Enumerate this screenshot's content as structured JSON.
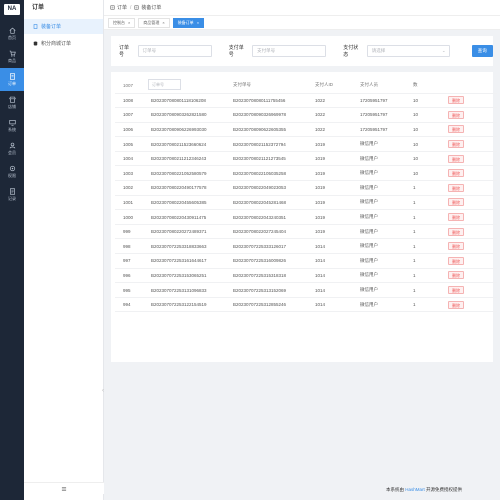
{
  "rail": {
    "logo": "NA",
    "items": [
      {
        "label": "首页",
        "icon": "home-icon"
      },
      {
        "label": "商品",
        "icon": "cart-icon"
      },
      {
        "label": "订单",
        "icon": "order-icon"
      },
      {
        "label": "店铺",
        "icon": "shop-icon"
      },
      {
        "label": "系统",
        "icon": "system-icon"
      },
      {
        "label": "会员",
        "icon": "member-icon"
      },
      {
        "label": "权限",
        "icon": "permission-icon"
      },
      {
        "label": "记录",
        "icon": "record-icon"
      }
    ]
  },
  "subnav": {
    "title": "订单",
    "items": [
      "装备订单",
      "积分商城订单"
    ]
  },
  "breadcrumb": {
    "first": "订单",
    "second": "装备订单"
  },
  "tabs": [
    {
      "label": "控制台"
    },
    {
      "label": "商品管理"
    },
    {
      "label": "装备订单"
    }
  ],
  "filter": {
    "order_no_label": "订单号",
    "order_no_placeholder": "订单号",
    "pay_no_label": "支付单号",
    "pay_no_placeholder": "支付单号",
    "status_label": "支付状态",
    "status_placeholder": "请选择",
    "query_button": "查询"
  },
  "table": {
    "first_header": "1007",
    "search_placeholder": "订单号",
    "headers": [
      "",
      "支付单号",
      "支付人ID",
      "支付人员",
      "数"
    ],
    "delete_label": "删除",
    "rows": [
      [
        "1008",
        "B202307080801118106208",
        "B20230708080111755456",
        "1022",
        "17205951797",
        "10"
      ],
      [
        "1007",
        "B202307080903262821580",
        "B20230708090326969978",
        "1022",
        "17205951797",
        "10"
      ],
      [
        "1006",
        "B202307080906226993030",
        "B20230708090622605355",
        "1022",
        "17205951797",
        "10"
      ],
      [
        "1005",
        "B202307080211523660624",
        "B20230708021152372794",
        "1019",
        "微信用户",
        "10"
      ],
      [
        "1004",
        "B202307080211212346243",
        "B20230708021121273545",
        "1019",
        "微信用户",
        "10"
      ],
      [
        "1003",
        "B202307080221052580579",
        "B20230708022105035258",
        "1019",
        "微信用户",
        "10"
      ],
      [
        "1002",
        "B202307080220490177578",
        "B20230708022049023053",
        "1019",
        "微信用户",
        "1"
      ],
      [
        "1001",
        "B202307080220455605385",
        "B20230708022045281468",
        "1019",
        "微信用户",
        "1"
      ],
      [
        "1000",
        "B202307080220430911475",
        "B20230708022043240351",
        "1019",
        "微信用户",
        "1"
      ],
      [
        "999",
        "B202307080220272489371",
        "B20230708022027245404",
        "1019",
        "微信用户",
        "1"
      ],
      [
        "998",
        "B202307072253318833663",
        "B20230707225333126017",
        "1014",
        "微信用户",
        "1"
      ],
      [
        "997",
        "B202307072253161644617",
        "B20230707225316009826",
        "1014",
        "微信用户",
        "1"
      ],
      [
        "996",
        "B202307072253153065251",
        "B20230707225315318318",
        "1014",
        "微信用户",
        "1"
      ],
      [
        "995",
        "B202307072253131096833",
        "B20230707225313152069",
        "1014",
        "微信用户",
        "1"
      ],
      [
        "994",
        "B202307072253122154519",
        "B20230707225312855246",
        "1014",
        "微信用户",
        "1"
      ]
    ]
  },
  "footer": {
    "prefix": "本系统由 ",
    "brand": "HashMart",
    "suffix": " 开源免费授权提供"
  }
}
